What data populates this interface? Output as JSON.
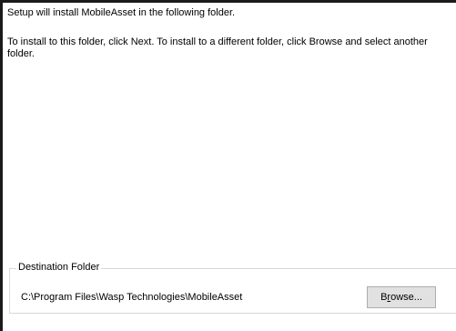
{
  "intro_text": "Setup will install MobileAsset in the following folder.",
  "instruction_text": "To install to this folder, click Next. To install to a different folder, click Browse and select another folder.",
  "destination": {
    "legend": "Destination Folder",
    "path": "C:\\Program Files\\Wasp Technologies\\MobileAsset",
    "browse_label": "Browse...",
    "browse_accesskey": "r"
  }
}
